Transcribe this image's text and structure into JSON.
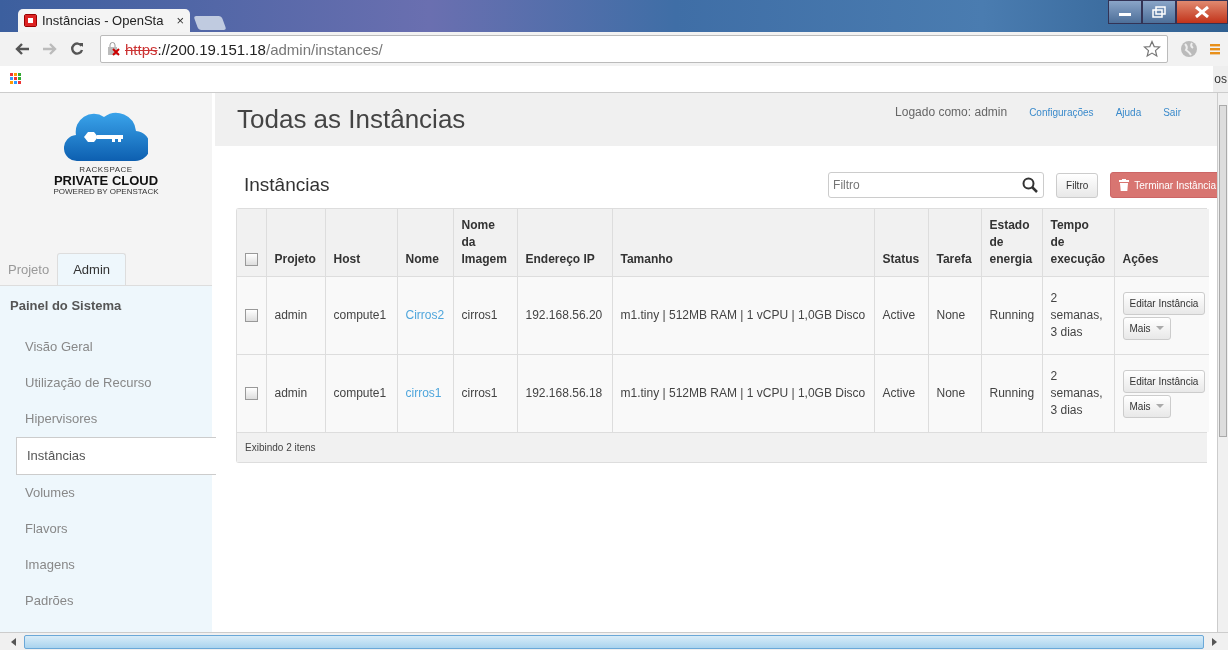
{
  "browser": {
    "tab_title": "Instâncias - OpenSta",
    "tab_close": "×",
    "url_scheme": "https",
    "url_rest": "://200.19.151.18",
    "url_path": "/admin/instances/",
    "bookmark_edge_text": "os"
  },
  "logo": {
    "line1": "RACKSPACE",
    "line2": "PRIVATE CLOUD",
    "line3": "POWERED BY OPENSTACK"
  },
  "sidebar": {
    "tabs": [
      {
        "label": "Projeto",
        "selected": false
      },
      {
        "label": "Admin",
        "selected": true
      }
    ],
    "panel_title": "Painel do Sistema",
    "items": [
      {
        "label": "Visão Geral",
        "selected": false
      },
      {
        "label": "Utilização de Recurso",
        "selected": false
      },
      {
        "label": "Hipervisores",
        "selected": false
      },
      {
        "label": "Instâncias",
        "selected": true
      },
      {
        "label": "Volumes",
        "selected": false
      },
      {
        "label": "Flavors",
        "selected": false
      },
      {
        "label": "Imagens",
        "selected": false
      },
      {
        "label": "Padrões",
        "selected": false
      }
    ]
  },
  "header": {
    "title": "Todas as Instâncias",
    "logged_in": "Logado como: admin",
    "links": [
      "Configurações",
      "Ajuda",
      "Sair"
    ]
  },
  "section": {
    "title": "Instâncias",
    "filter_placeholder": "Filtro",
    "filter_button": "Filtro",
    "terminate_button": "Terminar Instância"
  },
  "table": {
    "select_all_checked": false,
    "columns": [
      "Projeto",
      "Host",
      "Nome",
      "Nome da Imagem",
      "Endereço IP",
      "Tamanho",
      "Status",
      "Tarefa",
      "Estado de energia",
      "Tempo de execução",
      "Ações"
    ],
    "rows": [
      {
        "checked": false,
        "cells": [
          "admin",
          "compute1",
          "Cirros2",
          "cirros1",
          "192.168.56.20",
          "m1.tiny | 512MB RAM | 1 vCPU | 1,0GB Disco",
          "Active",
          "None",
          "Running",
          "2 semanas, 3 dias"
        ],
        "actions": [
          "Editar Instância",
          "Mais"
        ]
      },
      {
        "checked": false,
        "cells": [
          "admin",
          "compute1",
          "cirros1",
          "cirros1",
          "192.168.56.18",
          "m1.tiny | 512MB RAM | 1 vCPU | 1,0GB Disco",
          "Active",
          "None",
          "Running",
          "2 semanas, 3 dias"
        ],
        "actions": [
          "Editar Instância",
          "Mais"
        ]
      }
    ],
    "footer": "Exibindo 2 itens"
  }
}
